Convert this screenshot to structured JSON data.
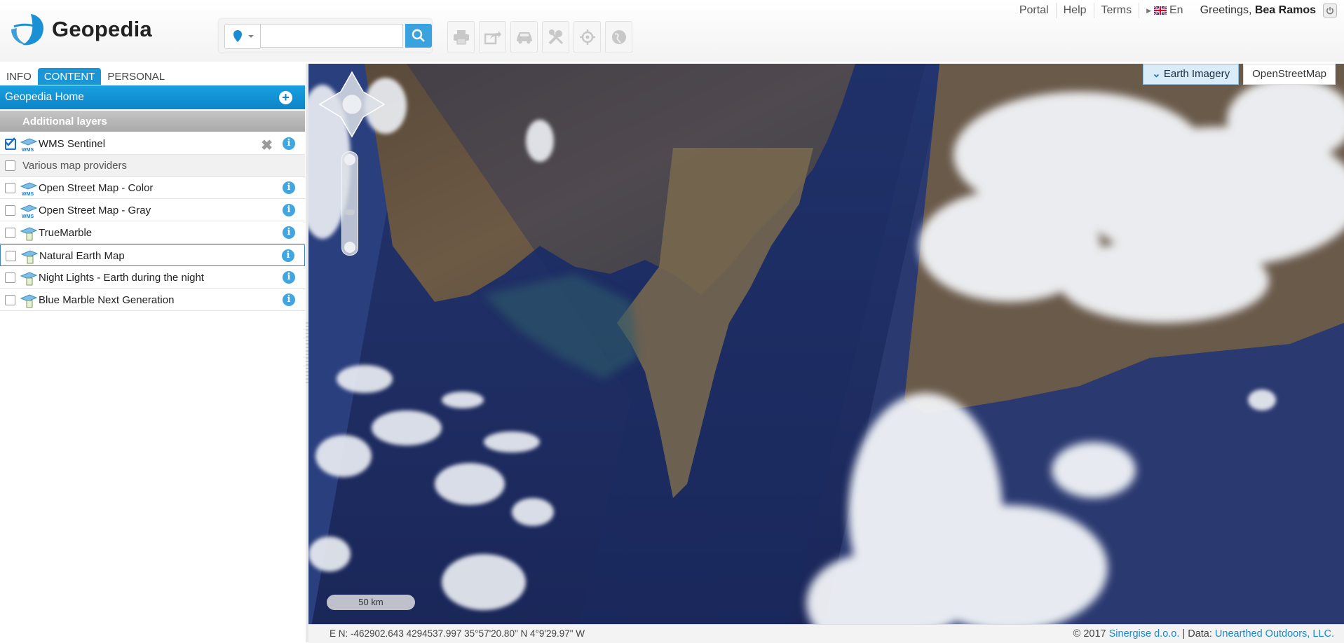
{
  "app": {
    "name": "Geopedia"
  },
  "header": {
    "nav_links": [
      "Portal",
      "Help",
      "Terms"
    ],
    "language": "En",
    "greeting_prefix": "Greetings,",
    "user_name": "Bea Ramos",
    "search": {
      "value": "",
      "placeholder": ""
    },
    "toolbar_icons": [
      "print-icon",
      "share-icon",
      "car-routing-icon",
      "tools-icon",
      "locate-icon",
      "globe-icon"
    ]
  },
  "sidebar": {
    "tabs": [
      {
        "label": "INFO",
        "active": false
      },
      {
        "label": "CONTENT",
        "active": true
      },
      {
        "label": "PERSONAL",
        "active": false
      }
    ],
    "panel_title": "Geopedia Home",
    "group_title": "Additional layers",
    "layers": [
      {
        "label": "WMS Sentinel",
        "checked": true,
        "icon": "wms-layer-icon",
        "removable": true
      },
      {
        "label": "Various map providers",
        "checked": false,
        "group": true
      },
      {
        "label": "Open Street Map - Color",
        "checked": false,
        "icon": "wms-layer-icon"
      },
      {
        "label": "Open Street Map - Gray",
        "checked": false,
        "icon": "wms-layer-icon"
      },
      {
        "label": "TrueMarble",
        "checked": false,
        "icon": "map-layer-icon"
      },
      {
        "label": "Natural Earth Map",
        "checked": false,
        "icon": "map-layer-icon",
        "selected": true
      },
      {
        "label": "Night Lights - Earth during the night",
        "checked": false,
        "icon": "map-layer-icon"
      },
      {
        "label": "Blue Marble Next Generation",
        "checked": false,
        "icon": "map-layer-icon"
      }
    ]
  },
  "map": {
    "basemaps": [
      {
        "label": "Earth Imagery",
        "active": true
      },
      {
        "label": "OpenStreetMap",
        "active": false
      }
    ],
    "scale_label": "50 km",
    "coordinates": "E N: -462902.643 4294537.997    35°57'20.80\" N 4°9'29.97\" W",
    "copyright_prefix": "© 2017",
    "copyright_company": "Sinergise d.o.o.",
    "data_prefix": "| Data:",
    "data_source": "Unearthed Outdoors, LLC."
  },
  "colors": {
    "accent": "#1a96d6",
    "search_button": "#3aa3df",
    "info": "#3ea6e0"
  }
}
